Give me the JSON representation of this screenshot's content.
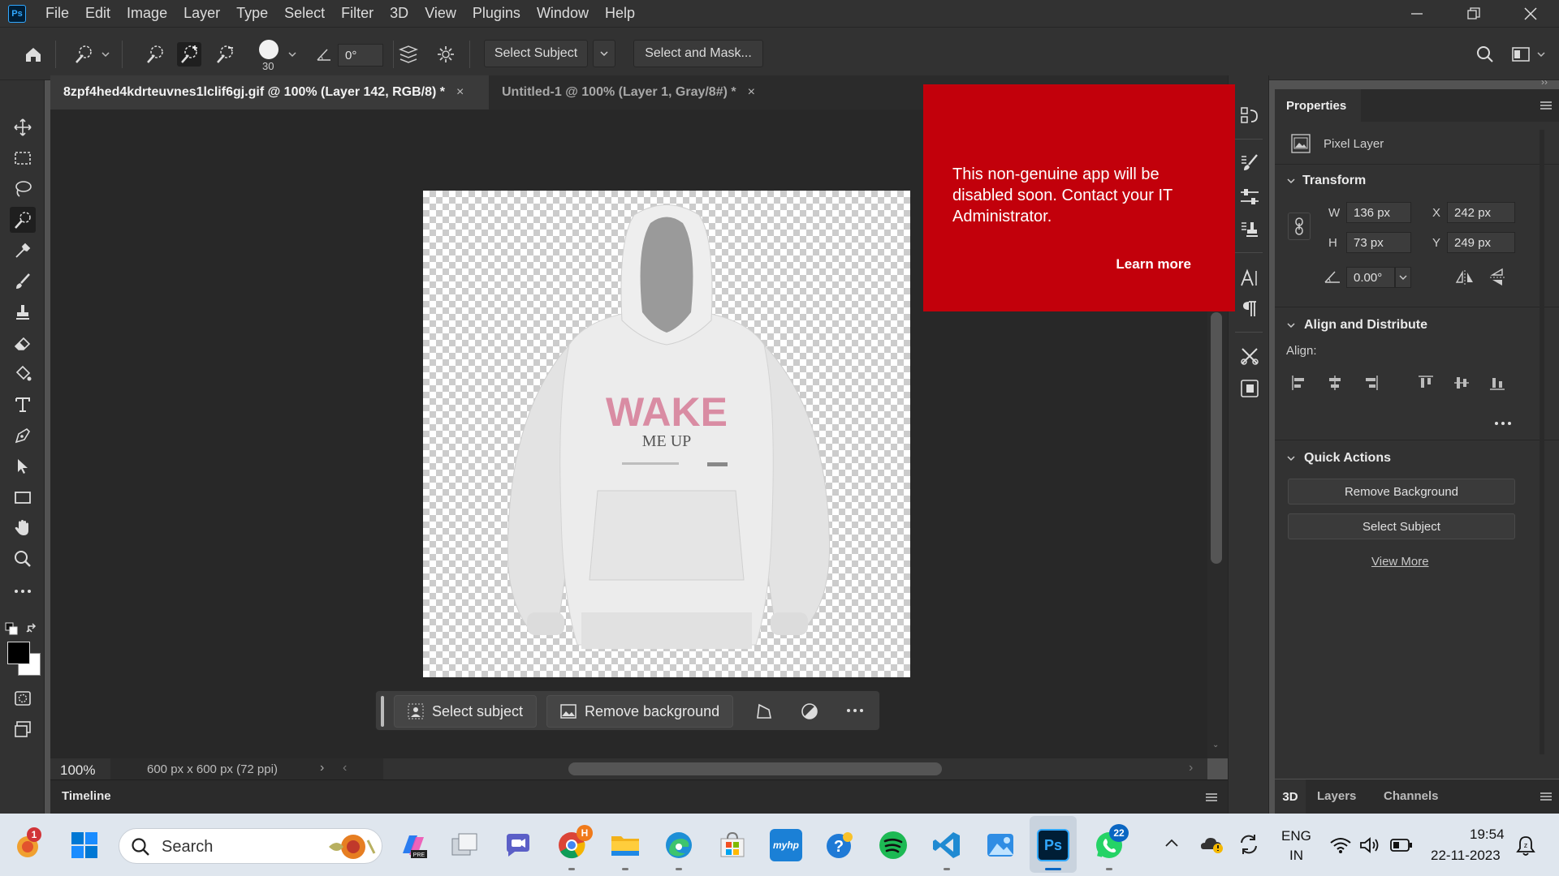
{
  "menu": [
    "File",
    "Edit",
    "Image",
    "Layer",
    "Type",
    "Select",
    "Filter",
    "3D",
    "View",
    "Plugins",
    "Window",
    "Help"
  ],
  "options": {
    "brush_size": "30",
    "angle": "0°",
    "select_subject_label": "Select Subject",
    "select_and_mask_label": "Select and Mask..."
  },
  "tabs": [
    {
      "label": "8zpf4hed4kdrteuvnes1lclif6gj.gif @ 100% (Layer 142, RGB/8) *",
      "active": true
    },
    {
      "label": "Untitled-1 @ 100% (Layer 1, Gray/8#) *",
      "active": false
    }
  ],
  "notification": {
    "message": "This non-genuine app will be disabled soon. Contact your IT Administrator.",
    "link": "Learn more",
    "color": "#c2000b"
  },
  "context_bar": {
    "select_subject": "Select subject",
    "remove_background": "Remove background"
  },
  "artwork": {
    "print_main": "WAKE",
    "print_sub": "ME UP"
  },
  "status": {
    "zoom": "100%",
    "doc_info": "600 px x 600 px (72 ppi)"
  },
  "timeline_label": "Timeline",
  "properties": {
    "tab": "Properties",
    "layer_type": "Pixel Layer",
    "transform_title": "Transform",
    "w_label": "W",
    "w_value": "136 px",
    "h_label": "H",
    "h_value": "73 px",
    "x_label": "X",
    "x_value": "242 px",
    "y_label": "Y",
    "y_value": "249 px",
    "angle": "0.00°",
    "align_title": "Align and Distribute",
    "align_label": "Align:",
    "quick_actions_title": "Quick Actions",
    "remove_background": "Remove Background",
    "select_subject": "Select Subject",
    "view_more": "View More"
  },
  "bottom_tabs": [
    "3D",
    "Layers",
    "Channels"
  ],
  "taskbar": {
    "search_placeholder": "Search",
    "notification_badge": "1",
    "chrome_badge": "H",
    "whatsapp_badge": "22",
    "lang_line1": "ENG",
    "lang_line2": "IN",
    "time": "19:54",
    "date": "22-11-2023",
    "hp_label": "myhp"
  },
  "colors": {
    "accent": "#31a8ff",
    "notification_red": "#c2000b",
    "panel_bg": "#323232",
    "canvas_bg": "#282828"
  }
}
